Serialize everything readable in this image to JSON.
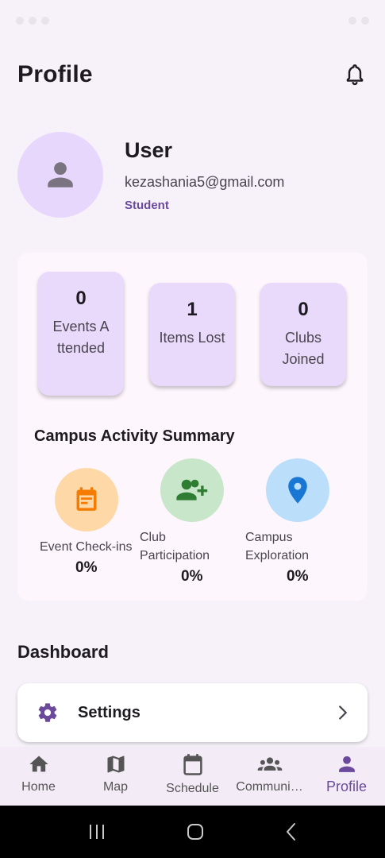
{
  "app": {
    "title": "Profile"
  },
  "profile": {
    "name": "User",
    "email": "kezashania5@gmail.com",
    "role": "Student"
  },
  "stats": [
    {
      "value": "0",
      "label": "Events Attended"
    },
    {
      "value": "1",
      "label": "Items Lost"
    },
    {
      "value": "0",
      "label": "Clubs Joined"
    }
  ],
  "activity": {
    "title": "Campus Activity Summary",
    "items": [
      {
        "label": "Event Check-ins",
        "value": "0%",
        "icon": "calendar-icon",
        "color": "#ffd8a8",
        "icon_color": "#f57c00"
      },
      {
        "label": "Club Participation",
        "value": "0%",
        "icon": "group-add-icon",
        "color": "#c8e6c9",
        "icon_color": "#2e7d32"
      },
      {
        "label": "Campus Exploration",
        "value": "0%",
        "icon": "location-pin-icon",
        "color": "#bbdefb",
        "icon_color": "#1976d2"
      }
    ]
  },
  "dashboard": {
    "title": "Dashboard",
    "settings_label": "Settings"
  },
  "nav": {
    "items": [
      {
        "label": "Home",
        "icon": "home-icon"
      },
      {
        "label": "Map",
        "icon": "map-icon"
      },
      {
        "label": "Schedule",
        "icon": "calendar-icon"
      },
      {
        "label": "Communi…",
        "icon": "groups-icon"
      },
      {
        "label": "Profile",
        "icon": "person-icon"
      }
    ],
    "active": "Profile"
  },
  "colors": {
    "accent": "#6b4a9c",
    "background": "#f7f2fa",
    "card": "#e9d9fb"
  }
}
